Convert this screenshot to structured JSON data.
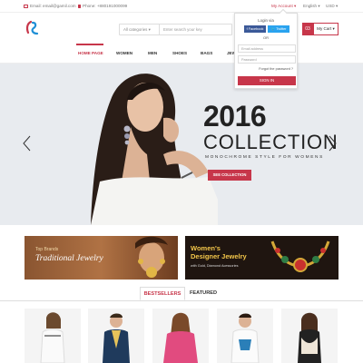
{
  "topbar": {
    "email": "Email: email@gamil.com",
    "phone": "Phone: +880191000099",
    "account": "My Account ▾",
    "language": "English ▾",
    "currency": "USD ▾"
  },
  "header": {
    "search_category": "All categories ▾",
    "search_placeholder": "Enter search your key",
    "cart_count": "03",
    "cart_label": "My Cart ▾"
  },
  "nav": {
    "items": [
      "HOME PAGE",
      "WOMEN",
      "MEN",
      "SHOES",
      "BAGS",
      "JEW"
    ]
  },
  "login_dropdown": {
    "title": "Login via",
    "facebook": "f Facebook",
    "twitter": "🐦 Twitter",
    "or": "OR",
    "email_placeholder": "Email address",
    "password_placeholder": "Password",
    "forgot": "Forgot the password ?",
    "signin": "SIGN IN"
  },
  "hero": {
    "year": "2016",
    "collection": "COLLECTION",
    "subtitle": "MONOCHROME STYLE FOR WOMENS",
    "button": "SEE COLLECTION"
  },
  "banners": {
    "left": {
      "brand": "Top Brands",
      "title": "Traditional Jewelry"
    },
    "right": {
      "line1": "Women's",
      "line2": "Designer Jewelry",
      "sub": "with Gold, Diamond Acessories"
    }
  },
  "product_tabs": [
    "BESTSELLERS",
    "FEATURED"
  ],
  "colors": {
    "accent": "#c7364a"
  }
}
